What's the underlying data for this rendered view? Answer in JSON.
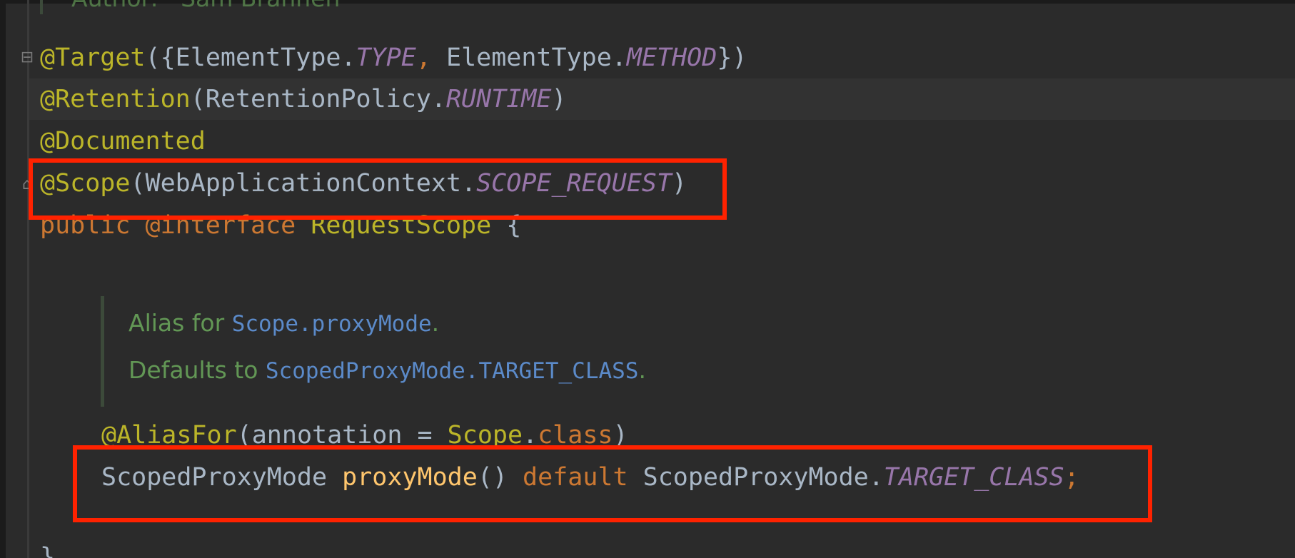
{
  "code": {
    "author_partial": "Author:   Sam Brannen",
    "target_line": {
      "annotation": "@Target",
      "open": "({",
      "cls1": "ElementType.",
      "const1": "TYPE",
      "sep": ", ",
      "cls2": "ElementType.",
      "const2": "METHOD",
      "close": "})"
    },
    "retention_line": {
      "annotation": "@Retention",
      "open": "(",
      "cls": "RetentionPolicy.",
      "const": "RUNTIME",
      "close": ")"
    },
    "documented_line": {
      "annotation": "@Documented"
    },
    "scope_line": {
      "annotation": "@Scope",
      "open": "(",
      "cls": "WebApplicationContext.",
      "const": "SCOPE_REQUEST",
      "close": ")"
    },
    "interface_line": {
      "public": "public",
      "at_interface": "@interface",
      "name": "RequestScope",
      "brace": "{"
    },
    "javadoc": {
      "line1_text": "Alias for ",
      "line1_link": "Scope.proxyMode",
      "line1_end": ".",
      "line2_text": "Defaults to ",
      "line2_link": "ScopedProxyMode.TARGET_CLASS",
      "line2_end": "."
    },
    "aliasfor_line": {
      "annotation": "@AliasFor",
      "open": "(",
      "param": "annotation = ",
      "type": "Scope",
      "dot": ".",
      "kw": "class",
      "close": ")"
    },
    "proxymode_line": {
      "return_type": "ScopedProxyMode",
      "method": "proxyMode",
      "parens": "()",
      "default_kw": "default",
      "cls": "ScopedProxyMode.",
      "const": "TARGET_CLASS",
      "semi": ";"
    },
    "closing_brace": "}"
  },
  "icons": {
    "fold_open": "fold-open-icon",
    "fold_end": "fold-end-icon"
  },
  "colors": {
    "background": "#2b2b2b",
    "annotation": "#bbb529",
    "keyword": "#cc7832",
    "constant": "#9876aa",
    "method": "#ffc66d",
    "javadoc": "#629755",
    "javadoc_link": "#5b8ac9",
    "highlight_box": "#ff2200"
  }
}
